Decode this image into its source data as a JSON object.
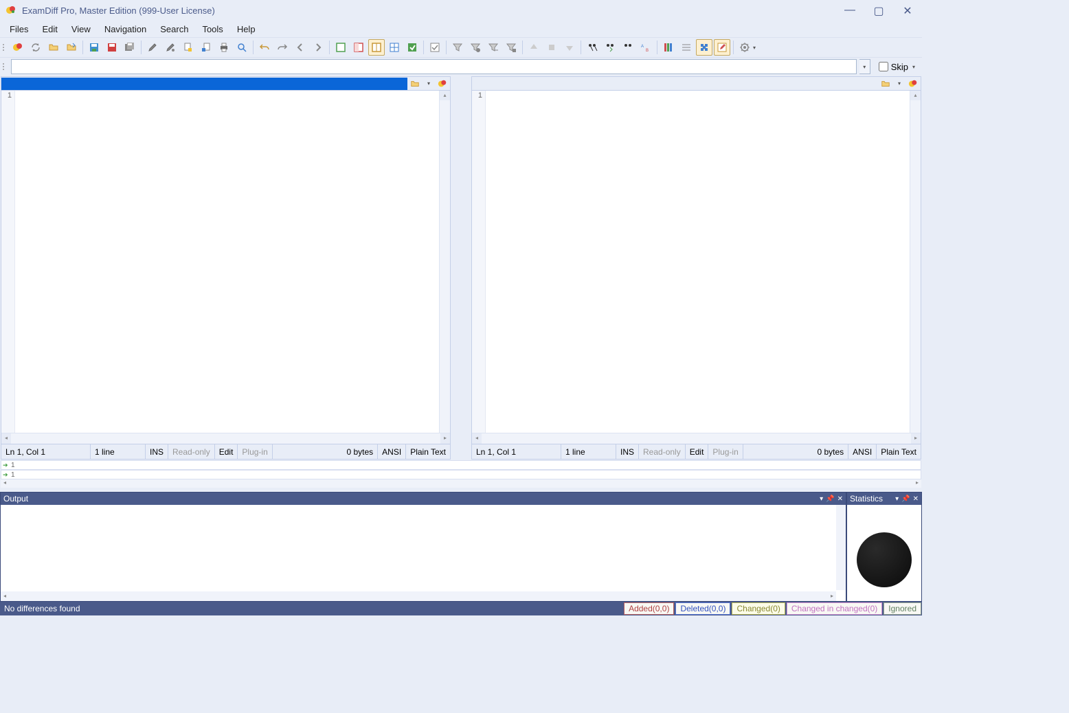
{
  "window": {
    "title": "ExamDiff Pro, Master Edition (999-User License)"
  },
  "menu": {
    "files": "Files",
    "edit": "Edit",
    "view": "View",
    "navigation": "Navigation",
    "search": "Search",
    "tools": "Tools",
    "help": "Help"
  },
  "address": {
    "value": "",
    "skip_label": "Skip"
  },
  "left": {
    "line_no": "1",
    "status": {
      "pos": "Ln 1, Col 1",
      "lines": "1 line",
      "ins": "INS",
      "readonly": "Read-only",
      "edit": "Edit",
      "plugin": "Plug-in",
      "bytes": "0 bytes",
      "encoding": "ANSI",
      "type": "Plain Text"
    }
  },
  "right": {
    "line_no": "1",
    "status": {
      "pos": "Ln 1, Col 1",
      "lines": "1 line",
      "ins": "INS",
      "readonly": "Read-only",
      "edit": "Edit",
      "plugin": "Plug-in",
      "bytes": "0 bytes",
      "encoding": "ANSI",
      "type": "Plain Text"
    }
  },
  "mini": {
    "row1": "1",
    "row2": "1"
  },
  "panels": {
    "output": "Output",
    "statistics": "Statistics"
  },
  "statusbar": {
    "message": "No differences found",
    "added": "Added(0,0)",
    "deleted": "Deleted(0,0)",
    "changed": "Changed(0)",
    "changed_in_changed": "Changed in changed(0)",
    "ignored": "Ignored"
  }
}
